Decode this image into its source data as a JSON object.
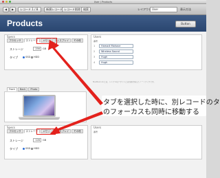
{
  "window": {
    "title": "User / Products"
  },
  "toolbar": {
    "record_label": "レコード 1 / 8",
    "new_record": "新規レコード",
    "delete_record": "レコード削除",
    "find": "検索",
    "layout_label": "レイアウト",
    "layout_value": "User",
    "view_label": "表示方法"
  },
  "header": {
    "title": "Products",
    "button": "Button"
  },
  "top_section": {
    "spec_label": "Specs",
    "tabs": [
      "プロセッサ",
      "ストレージ",
      "メモリ",
      "ディスプレイ",
      "その他"
    ],
    "storage_label": "ストレージ",
    "storage_value": "256",
    "storage_unit": "GB",
    "type_label": "タイプ",
    "type_options": [
      "SSD",
      "HDD"
    ],
    "type_selected": "SSD"
  },
  "users_top": {
    "header": "Users",
    "subheader": "番号",
    "rows": [
      {
        "n": "1",
        "name": "Hamadi Mohave"
      },
      {
        "n": "2",
        "name": "Wireless Sound"
      },
      {
        "n": "3",
        "name": "Hugh"
      },
      {
        "n": "4",
        "name": "Hugh"
      }
    ]
  },
  "image_tabs": [
    "Front",
    "Back",
    "Photo"
  ],
  "description": "MacBook Airとは、シンプルなデザインと高性能を備えたノートブックです。",
  "callout": {
    "line1": "タブを選択した時に、別レコードのタブ",
    "line2": "のフォーカスも同時に移動する"
  },
  "bottom_section": {
    "spec_label": "Specs",
    "tabs": [
      "プロセッサ",
      "ストレージ",
      "メモリ",
      "ディスプレイ",
      "その他"
    ],
    "storage_label": "ストレージ",
    "storage_value": "128",
    "storage_unit": "GB",
    "type_label": "タイプ",
    "type_options": [
      "SSD",
      "HDD"
    ],
    "type_selected": "SSD"
  },
  "users_bottom": {
    "header": "Users",
    "subheader": "番号"
  },
  "colors": {
    "header_bg": "#2f4d78",
    "highlight": "#e3211c",
    "arrow": "#e3211c"
  }
}
